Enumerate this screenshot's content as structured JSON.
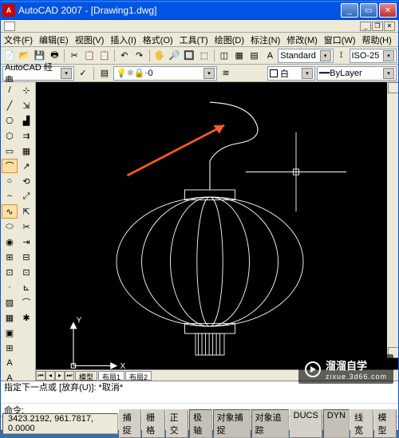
{
  "domain": "Computer-Use",
  "app_title": "AutoCAD 2007 - [Drawing1.dwg]",
  "doc_title": "Drawing1.dwg",
  "menus": [
    "文件(F)",
    "编辑(E)",
    "视图(V)",
    "插入(I)",
    "格式(O)",
    "工具(T)",
    "绘图(D)",
    "标注(N)",
    "修改(M)",
    "窗口(W)",
    "帮助(H)"
  ],
  "workspace_combo": "AutoCAD 经典",
  "layer_combo": "0",
  "style_combo": "Standard",
  "dimstyle_combo": "ISO-25",
  "color_label": "白",
  "linetype_combo": "ByLayer",
  "toolbar_icons": [
    "📄",
    "📂",
    "💾",
    "🖶",
    "✂",
    "📋",
    "📋",
    "↶",
    "↷",
    "🔍",
    "🖐",
    "🔎",
    "🔲",
    "⬚",
    "A",
    "◫",
    "▦",
    "▤"
  ],
  "draw_tools": [
    {
      "g": "/",
      "n": "line-tool"
    },
    {
      "g": "╱",
      "n": "xline-tool"
    },
    {
      "g": "⎔",
      "n": "polyline-tool"
    },
    {
      "g": "⬡",
      "n": "polygon-tool"
    },
    {
      "g": "▭",
      "n": "rectangle-tool"
    },
    {
      "g": "⌒",
      "n": "arc-tool",
      "hl": true
    },
    {
      "g": "○",
      "n": "circle-tool"
    },
    {
      "g": "~",
      "n": "revcloud-tool"
    },
    {
      "g": "∿",
      "n": "spline-tool",
      "hl": true
    },
    {
      "g": "⬭",
      "n": "ellipse-tool"
    },
    {
      "g": "◉",
      "n": "ellipse-arc-tool"
    },
    {
      "g": "⊞",
      "n": "insert-block"
    },
    {
      "g": "⊡",
      "n": "make-block"
    },
    {
      "g": "·",
      "n": "point-tool"
    },
    {
      "g": "▨",
      "n": "hatch-tool"
    },
    {
      "g": "▦",
      "n": "gradient-tool"
    },
    {
      "g": "▣",
      "n": "region-tool"
    },
    {
      "g": "⊞",
      "n": "table-tool"
    },
    {
      "g": "A",
      "n": "mtext-tool"
    },
    {
      "g": "A",
      "n": "text-tool"
    }
  ],
  "modify_tools": [
    {
      "g": "⊹",
      "n": "erase-tool"
    },
    {
      "g": "⇲",
      "n": "copy-tool"
    },
    {
      "g": "▟",
      "n": "mirror-tool"
    },
    {
      "g": "⇉",
      "n": "offset-tool"
    },
    {
      "g": "▦",
      "n": "array-tool"
    },
    {
      "g": "↗",
      "n": "move-tool"
    },
    {
      "g": "⟲",
      "n": "rotate-tool"
    },
    {
      "g": "⤢",
      "n": "scale-tool"
    },
    {
      "g": "⇱",
      "n": "stretch-tool"
    },
    {
      "g": "✂",
      "n": "trim-tool"
    },
    {
      "g": "⇥",
      "n": "extend-tool"
    },
    {
      "g": "⊟",
      "n": "break-at-point"
    },
    {
      "g": "⊡",
      "n": "break-tool"
    },
    {
      "g": "⊾",
      "n": "chamfer-tool"
    },
    {
      "g": "⌒",
      "n": "fillet-tool"
    },
    {
      "g": "✱",
      "n": "explode-tool"
    }
  ],
  "model_tabs": [
    "模型",
    "布局1",
    "布局2"
  ],
  "active_tab": 0,
  "axes": {
    "x": "X",
    "y": "Y"
  },
  "cmd_history": "指定下一点或 [放弃(U)]: *取消*",
  "cmd_prompt": "命令:",
  "coords": "3423.2192, 961.7817, 0.0000",
  "status_buttons": [
    {
      "l": "捕捉",
      "p": false
    },
    {
      "l": "栅格",
      "p": false
    },
    {
      "l": "正交",
      "p": false
    },
    {
      "l": "极轴",
      "p": true
    },
    {
      "l": "对象捕捉",
      "p": true
    },
    {
      "l": "对象追踪",
      "p": true
    },
    {
      "l": "DUCS",
      "p": false
    },
    {
      "l": "DYN",
      "p": true
    },
    {
      "l": "线宽",
      "p": false
    },
    {
      "l": "模型",
      "p": false
    }
  ],
  "watermark": {
    "brand": "溜溜自学",
    "url": "zixue.3d66.com"
  }
}
